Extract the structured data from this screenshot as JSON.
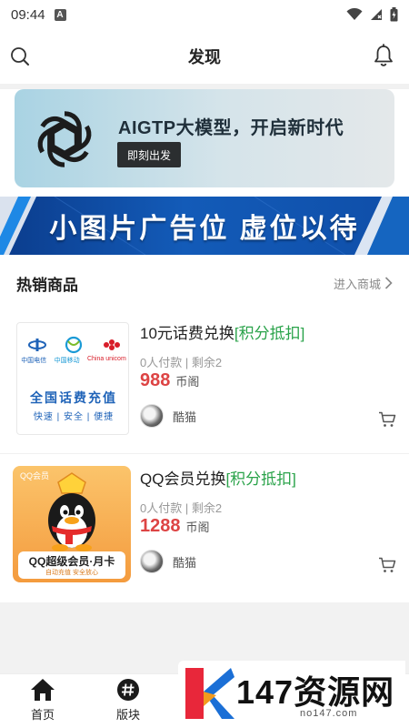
{
  "status_bar": {
    "time": "09:44",
    "notification_letter": "A"
  },
  "header": {
    "title": "发现"
  },
  "ai_banner": {
    "title": "AIGTP大模型，开启新时代",
    "button_label": "即刻出发"
  },
  "ad_banner": {
    "text": "小图片广告位 虚位以待"
  },
  "section": {
    "title": "热销商品",
    "link_label": "进入商城"
  },
  "products": [
    {
      "title": "10元话费兑换",
      "tag": "[积分抵扣]",
      "meta": "0人付款 | 剩余2",
      "price": "988",
      "unit": "币阁",
      "seller": "酷猫",
      "thumb": {
        "title": "全国话费充值",
        "subtitle": "快速 | 安全 | 便捷",
        "logos": [
          "中国电信",
          "中国移动",
          "China unicom"
        ]
      }
    },
    {
      "title": "QQ会员兑换",
      "tag": "[积分抵扣]",
      "meta": "0人付款 | 剩余2",
      "price": "1288",
      "unit": "币阁",
      "seller": "酷猫",
      "thumb": {
        "badge": "QQ会员",
        "title": "QQ超级会员·月卡",
        "subtitle": "自动充值 安全放心"
      }
    }
  ],
  "tab_bar": {
    "tabs": [
      {
        "label": "首页",
        "icon": "home-icon"
      },
      {
        "label": "版块",
        "icon": "hashtag-icon"
      }
    ]
  },
  "watermark": {
    "text": "147资源网",
    "url": "no147.com"
  },
  "colors": {
    "accent_green": "#2aa34a",
    "price_red": "#d44444",
    "ad_blue": "#135bb8"
  }
}
